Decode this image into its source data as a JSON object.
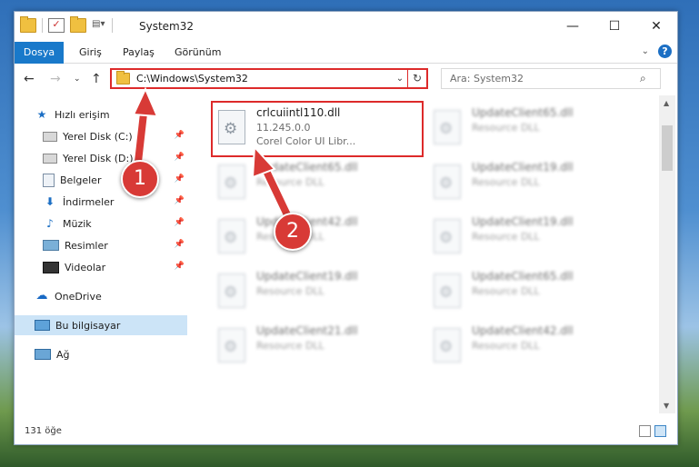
{
  "window": {
    "title": "System32",
    "controls": {
      "minimize": "—",
      "maximize": "☐",
      "close": "✕"
    }
  },
  "ribbon": {
    "tabs": [
      "Dosya",
      "Giriş",
      "Paylaş",
      "Görünüm"
    ]
  },
  "nav": {
    "address": "C:\\Windows\\System32",
    "search_placeholder": "Ara: System32"
  },
  "sidebar": {
    "quick_access": "Hızlı erişim",
    "items": [
      {
        "label": "Yerel Disk (C:)",
        "icon": "drive-icon"
      },
      {
        "label": "Yerel Disk (D:)",
        "icon": "drive-icon"
      },
      {
        "label": "Belgeler",
        "icon": "documents-icon"
      },
      {
        "label": "İndirmeler",
        "icon": "download-icon"
      },
      {
        "label": "Müzik",
        "icon": "music-icon"
      },
      {
        "label": "Resimler",
        "icon": "pictures-icon"
      },
      {
        "label": "Videolar",
        "icon": "videos-icon"
      }
    ],
    "onedrive": "OneDrive",
    "this_pc": "Bu bilgisayar",
    "network": "Ağ"
  },
  "files": [
    {
      "name": "crlcuiintl110.dll",
      "line2": "11.245.0.0",
      "line3": "Corel Color UI Libr..."
    },
    {
      "name": "UpdateClient65.dll",
      "line2": "Resource DLL"
    },
    {
      "name": "UpdateClient65.dll",
      "line2": "Resource DLL"
    },
    {
      "name": "UpdateClient19.dll",
      "line2": "Resource DLL"
    },
    {
      "name": "UpdateClient42.dll",
      "line2": "Resource DLL"
    },
    {
      "name": "UpdateClient19.dll",
      "line2": "Resource DLL"
    },
    {
      "name": "UpdateClient19.dll",
      "line2": "Resource DLL"
    },
    {
      "name": "UpdateClient65.dll",
      "line2": "Resource DLL"
    },
    {
      "name": "UpdateClient21.dll",
      "line2": "Resource DLL"
    },
    {
      "name": "UpdateClient42.dll",
      "line2": "Resource DLL"
    }
  ],
  "status": {
    "item_count": "131 öğe"
  },
  "annotations": {
    "badge1": "1",
    "badge2": "2",
    "color": "#d83a36"
  }
}
